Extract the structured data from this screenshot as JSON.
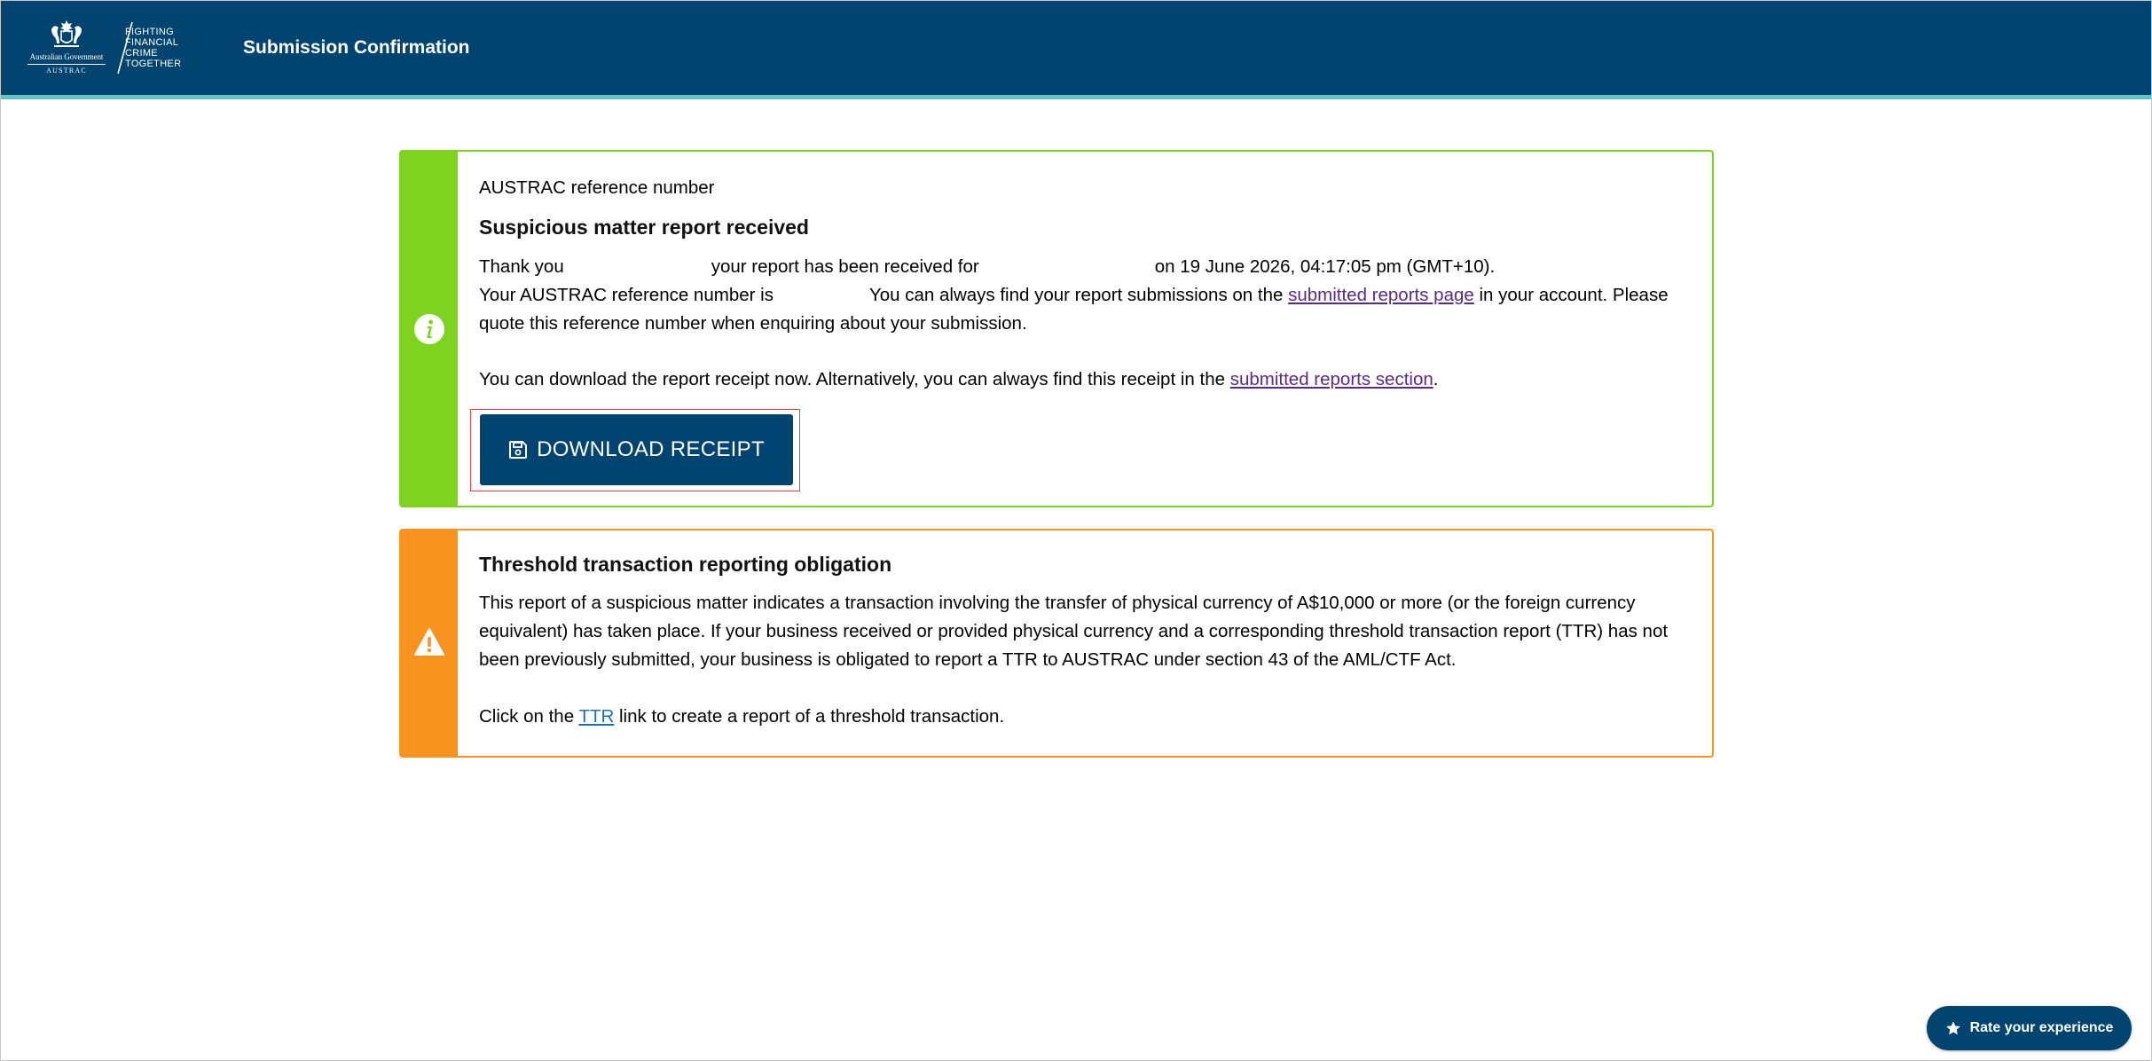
{
  "header": {
    "gov_text": "Australian Government",
    "agency_text": "AUSTRAC",
    "tagline": [
      "FIGHTING",
      "FINANCIAL",
      "CRIME",
      "TOGETHER"
    ],
    "title": "Submission Confirmation",
    "background_color": "#00446f",
    "accent_color": "#5fc3c7"
  },
  "success_card": {
    "icon": "info-icon",
    "border_color": "#7ed321",
    "ref_label": "AUSTRAC reference number",
    "heading": "Suspicious matter report received",
    "thanks_prefix": "Thank you",
    "thanks_mid": "your report has been received for",
    "thanks_suffix": "on 19 June 2026, 04:17:05 pm (GMT+10).",
    "ref_prefix": "Your AUSTRAC reference number is",
    "ref_suffix": "You can always find your report submissions on the",
    "submitted_reports_page_link": "submitted reports page",
    "ref_tail": "in your account. Please quote this reference number when enquiring about your submission.",
    "download_text": "You can download the report receipt now. Alternatively, you can always find this receipt in the",
    "submitted_reports_section_link": "submitted reports section",
    "download_text_end": ".",
    "download_button": "DOWNLOAD RECEIPT"
  },
  "warning_card": {
    "icon": "warning-icon",
    "border_color": "#f7931e",
    "heading": "Threshold transaction reporting obligation",
    "body": "This report of a suspicious matter indicates a transaction involving the transfer of physical currency of A$10,000 or more (or the foreign currency equivalent) has taken place. If your business received or provided physical currency and a corresponding threshold transaction report (TTR) has not been previously submitted, your business is obligated to report a TTR to AUSTRAC under section 43 of the AML/CTF Act.",
    "click_prefix": "Click on the",
    "ttr_link": "TTR",
    "click_suffix": "link to create a report of a threshold transaction."
  },
  "rate_button": {
    "label": "Rate your experience",
    "icon": "star-icon"
  }
}
